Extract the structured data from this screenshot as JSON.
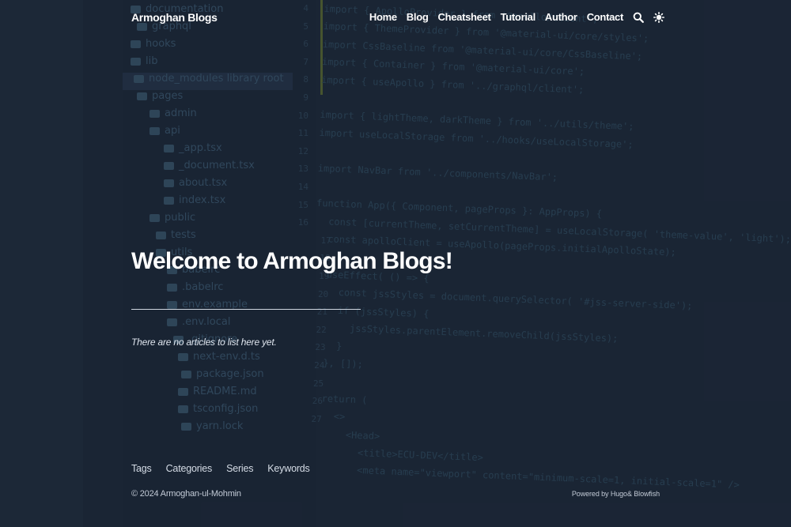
{
  "header": {
    "site_title": "Armoghan Blogs",
    "nav": [
      {
        "label": "Home"
      },
      {
        "label": "Blog"
      },
      {
        "label": "Cheatsheet"
      },
      {
        "label": "Tutorial"
      },
      {
        "label": "Author"
      },
      {
        "label": "Contact"
      }
    ],
    "icons": [
      "search-icon",
      "theme-toggle-icon"
    ]
  },
  "main": {
    "title": "Welcome to Armoghan Blogs!",
    "empty_message": "There are no articles to list here yet."
  },
  "footer": {
    "links": [
      {
        "label": "Tags"
      },
      {
        "label": "Categories"
      },
      {
        "label": "Series"
      },
      {
        "label": "Keywords"
      }
    ],
    "copyright": "© 2024 Armoghan-ul-Mohmin",
    "powered_prefix": "Powered by ",
    "powered_hugo": "Hugo",
    "powered_amp": " & ",
    "powered_blowfish": "Blowfish"
  },
  "background": {
    "tree": [
      "documentation",
      "graphql",
      "hooks",
      "lib",
      "node_modules  library root",
      "pages",
      "admin",
      "api",
      "_app.tsx",
      "_document.tsx",
      "about.tsx",
      "index.tsx",
      "public",
      "tests",
      "utils",
      "babelrc",
      ".babelrc",
      "env.example",
      ".env.local",
      ".gitignore",
      "next-env.d.ts",
      "package.json",
      "README.md",
      "tsconfig.json",
      "yarn.lock"
    ],
    "line_numbers": [
      "4",
      "5",
      "6",
      "7",
      "8",
      "9",
      "10",
      "11",
      "12",
      "13",
      "14",
      "15",
      "16",
      "17",
      "18",
      "19",
      "20",
      "21",
      "22",
      "23",
      "24",
      "25",
      "26",
      "27"
    ],
    "code": [
      "import { ApolloProvider } from '@apollo/client';",
      "import { ThemeProvider } from '@material-ui/core/styles';",
      "import CssBaseline from '@material-ui/core/CssBaseline';",
      "import { Container } from '@material-ui/core';",
      "import { useApollo } from '../graphql/client';",
      "",
      "import { lightTheme, darkTheme } from '../utils/theme';",
      "import useLocalStorage from '../hooks/useLocalStorage';",
      "",
      "import NavBar from '../components/NavBar';",
      "",
      "function App({ Component, pageProps }: AppProps) {",
      "  const [currentTheme, setCurrentTheme] = useLocalStorage( 'theme-value', 'light');",
      "  const apolloClient = useApollo(pageProps.initialApolloState);",
      "",
      "  useEffect( () => {",
      "    const jssStyles = document.querySelector( '#jss-server-side');",
      "    if (jssStyles) {",
      "      jssStyles.parentElement.removeChild(jssStyles);",
      "    }",
      "  }, []);",
      "",
      "  return (",
      "    <>",
      "      <Head>",
      "        <title>ECU-DEV</title>",
      "        <meta name=\"viewport\" content=\"minimum-scale=1, initial-scale=1\" />"
    ]
  },
  "colors": {
    "page_background": "#1b2535",
    "text": "#ffffff",
    "muted_text": "#c2cad6",
    "rule": "#cfd6e0"
  }
}
